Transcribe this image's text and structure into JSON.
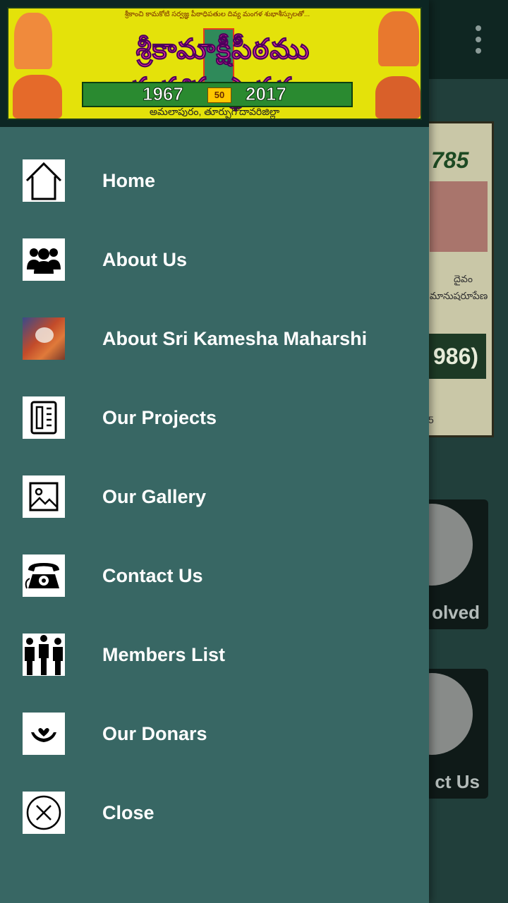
{
  "background": {
    "poster": {
      "number_text": "785",
      "telugu_word": "దైవం",
      "telugu_phrase": "మానుషరూపేణ",
      "year_badge": "986)",
      "footer_num": "5"
    },
    "tiles": [
      {
        "label": "olved"
      },
      {
        "label": "ct Us"
      }
    ]
  },
  "header": {
    "banner": {
      "top_line": "శ్రీకాంచి కామకోటి సర్వజ్ఞ పీఠాధిపతుల దివ్య మంగళ శుభాశీస్సులతో...",
      "main_title": "శ్రీకామాక్షీపీఠము మహాసంస్థానము",
      "year_start": "1967",
      "anniversary": "50",
      "year_end": "2017",
      "place": "అమలాపురం, తూర్పుగోదావరిజిల్లా"
    }
  },
  "menu": {
    "items": [
      {
        "label": "Home",
        "icon": "home-icon"
      },
      {
        "label": "About Us",
        "icon": "group-icon"
      },
      {
        "label": "About Sri Kamesha Maharshi",
        "icon": "portrait-photo-icon"
      },
      {
        "label": "Our Projects",
        "icon": "projects-icon"
      },
      {
        "label": "Our Gallery",
        "icon": "gallery-icon"
      },
      {
        "label": "Contact Us",
        "icon": "telephone-icon"
      },
      {
        "label": "Members List",
        "icon": "members-icon"
      },
      {
        "label": "Our Donars",
        "icon": "donation-hands-icon"
      },
      {
        "label": "Close",
        "icon": "close-circle-icon"
      }
    ]
  },
  "colors": {
    "drawer_bg": "#386764",
    "header_bg": "#0c2623",
    "app_bar_bg": "#0f2622",
    "text": "#ffffff"
  }
}
